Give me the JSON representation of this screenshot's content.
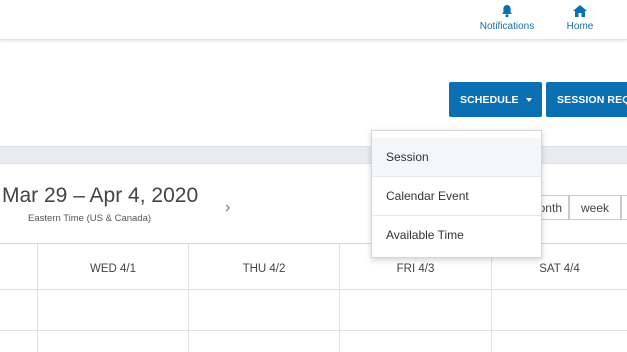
{
  "header": {
    "notifications_label": "Notifications",
    "home_label": "Home"
  },
  "toolbar": {
    "schedule_label": "SCHEDULE",
    "session_requests_label": "SESSION REQ"
  },
  "schedule_menu": {
    "items": [
      "Session",
      "Calendar Event",
      "Available Time"
    ]
  },
  "calendar": {
    "date_range": "Mar 29 – Apr 4, 2020",
    "timezone": "Eastern Time (US & Canada)",
    "next_glyph": "›",
    "views": {
      "month": "month",
      "week": "week"
    },
    "day_headers": [
      "WED 4/1",
      "THU 4/2",
      "FRI 4/3",
      "SAT 4/4"
    ]
  },
  "colors": {
    "primary": "#0b6fb4",
    "nav_text": "#1b6ea9",
    "band": "#e9edf1"
  }
}
